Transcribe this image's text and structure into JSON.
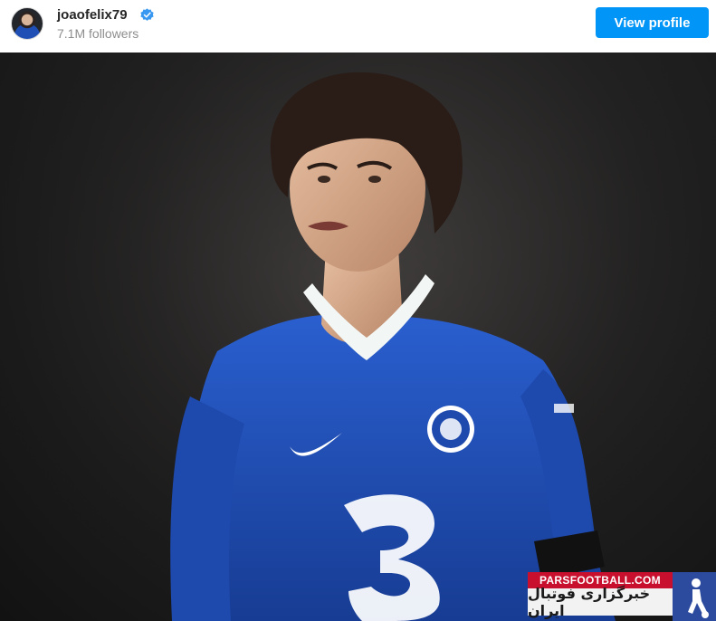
{
  "header": {
    "username": "joaofelix79",
    "followers": "7.1M followers",
    "view_profile_label": "View profile",
    "verified_color": "#3897f0",
    "button_color": "#0095f6"
  },
  "post": {
    "image_icon": "photo-of-player"
  },
  "watermark": {
    "site": "PARSFOOTBALL.COM",
    "persian_text": "خبرگزاری فوتبال ایران",
    "logo_icon": "player-silhouette-logo"
  }
}
